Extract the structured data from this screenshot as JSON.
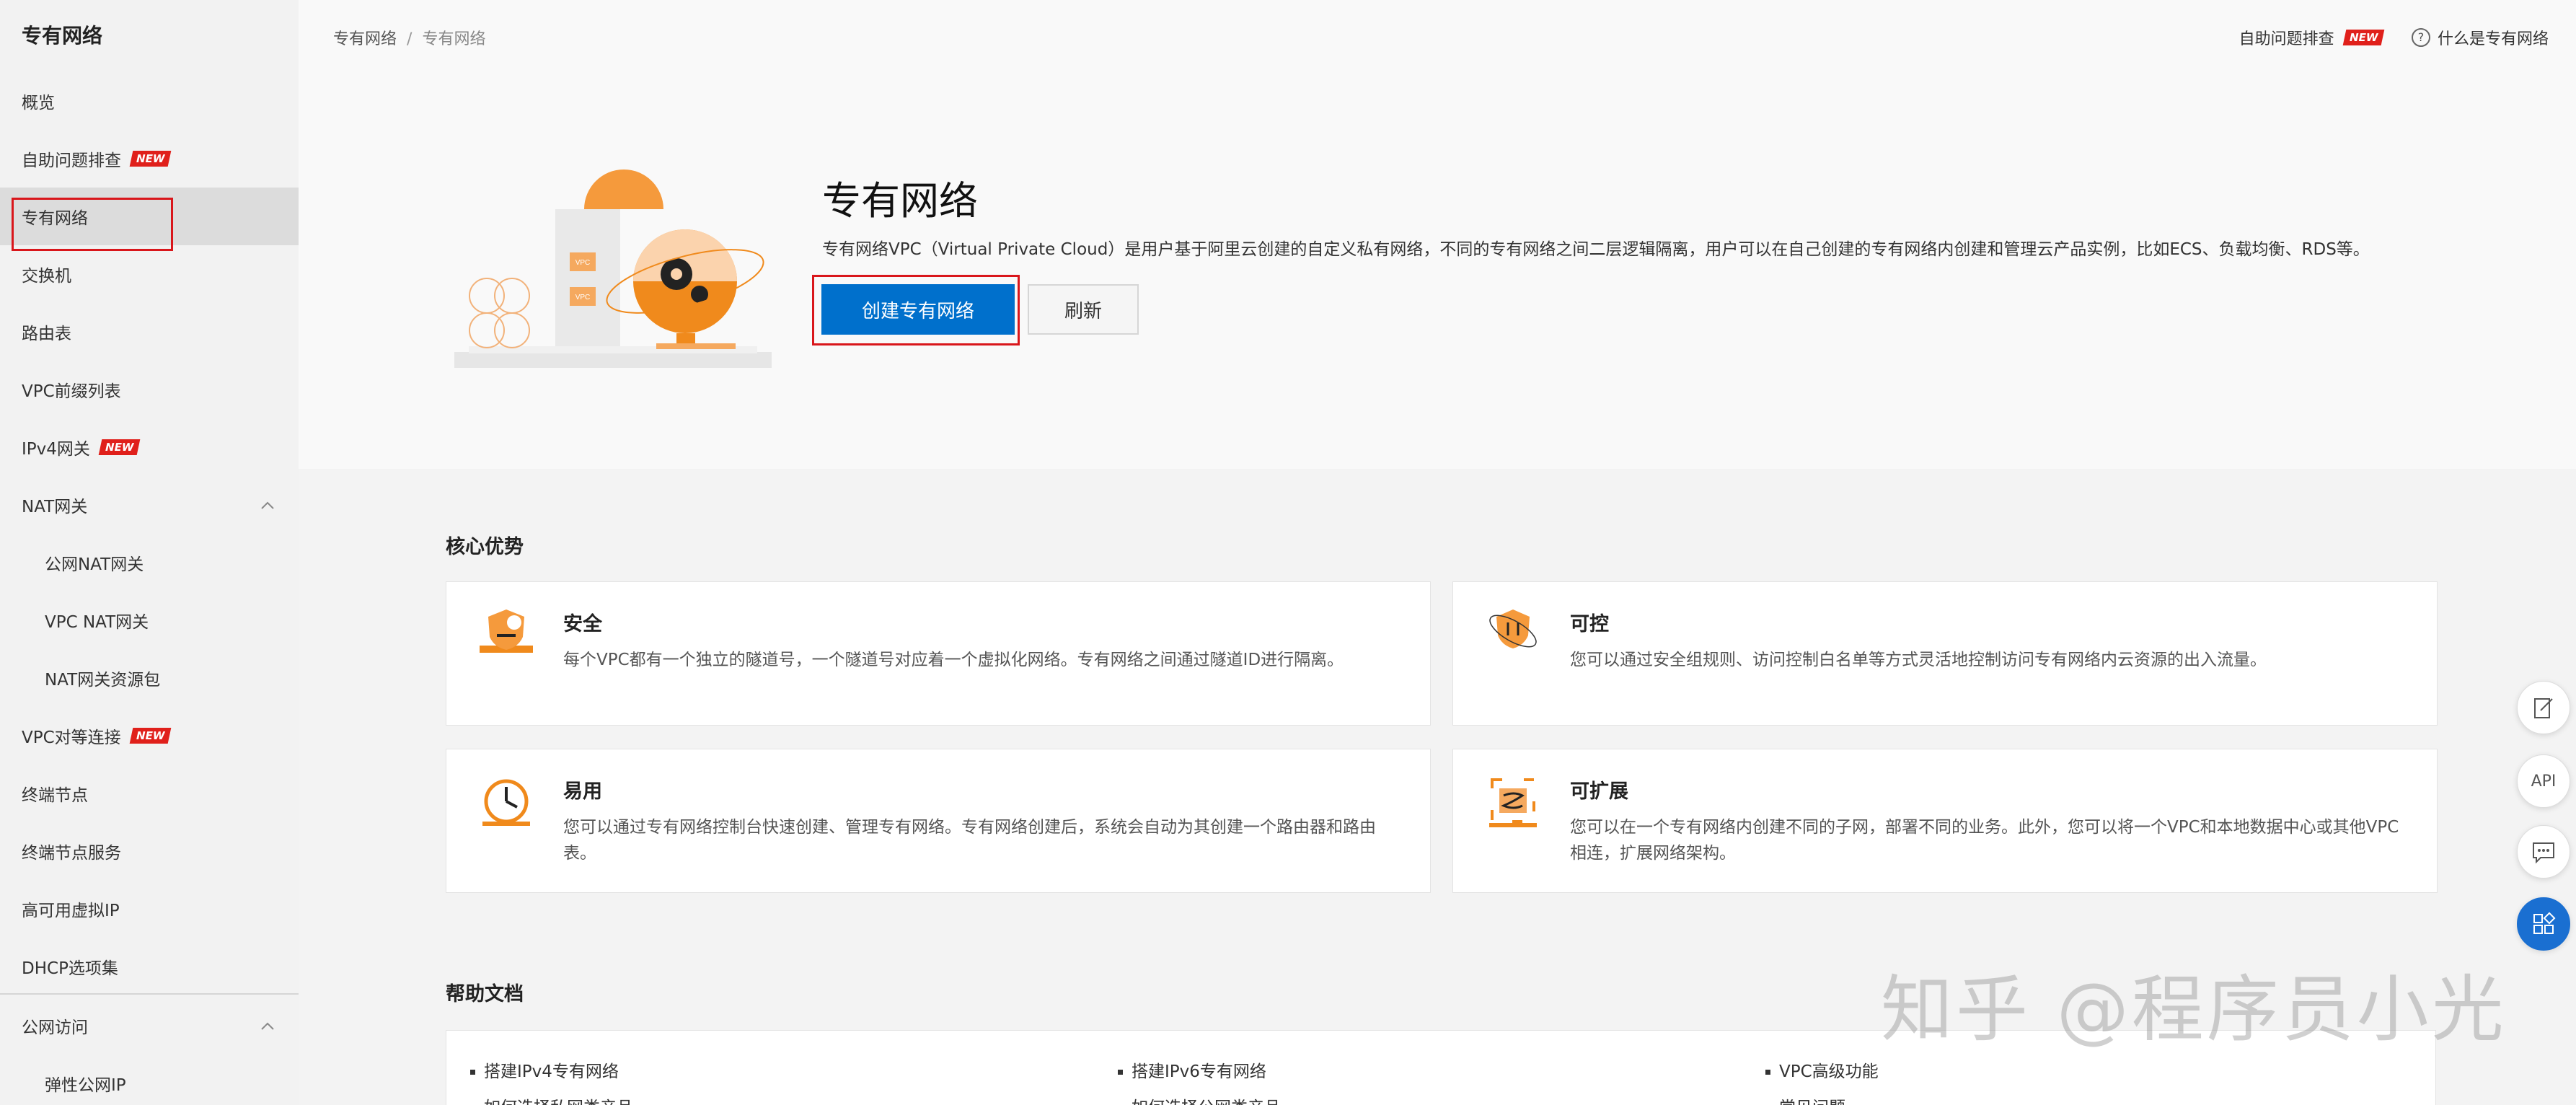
{
  "sidebar": {
    "title": "专有网络",
    "new_badge": "NEW",
    "items": [
      {
        "label": "概览"
      },
      {
        "label": "自助问题排查"
      },
      {
        "label": "专有网络"
      },
      {
        "label": "交换机"
      },
      {
        "label": "路由表"
      },
      {
        "label": "VPC前缀列表"
      },
      {
        "label": "IPv4网关"
      },
      {
        "label": "NAT网关"
      },
      {
        "label": "公网NAT网关"
      },
      {
        "label": "VPC NAT网关"
      },
      {
        "label": "NAT网关资源包"
      },
      {
        "label": "VPC对等连接"
      },
      {
        "label": "终端节点"
      },
      {
        "label": "终端节点服务"
      },
      {
        "label": "高可用虚拟IP"
      },
      {
        "label": "DHCP选项集"
      },
      {
        "label": "公网访问"
      },
      {
        "label": "弹性公网IP"
      }
    ]
  },
  "breadcrumb": {
    "root": "专有网络",
    "sep": "/",
    "current": "专有网络"
  },
  "topright": {
    "troubleshoot": "自助问题排查",
    "new_badge": "NEW",
    "help_q": "?",
    "what_is": "什么是专有网络"
  },
  "hero": {
    "title": "专有网络",
    "description": "专有网络VPC（Virtual Private Cloud）是用户基于阿里云创建的自定义私有网络，不同的专有网络之间二层逻辑隔离，用户可以在自己创建的专有网络内创建和管理云产品实例，比如ECS、负载均衡、RDS等。",
    "create_button": "创建专有网络",
    "refresh_button": "刷新",
    "illus_label_1": "VPC",
    "illus_label_2": "VPC"
  },
  "advantages": {
    "title": "核心优势",
    "cards": [
      {
        "title": "安全",
        "desc": "每个VPC都有一个独立的隧道号，一个隧道号对应着一个虚拟化网络。专有网络之间通过隧道ID进行隔离。"
      },
      {
        "title": "可控",
        "desc": "您可以通过安全组规则、访问控制白名单等方式灵活地控制访问专有网络内云资源的出入流量。"
      },
      {
        "title": "易用",
        "desc": "您可以通过专有网络控制台快速创建、管理专有网络。专有网络创建后，系统会自动为其创建一个路由器和路由表。"
      },
      {
        "title": "可扩展",
        "desc": "您可以在一个专有网络内创建不同的子网，部署不同的业务。此外，您可以将一个VPC和本地数据中心或其他VPC相连，扩展网络架构。"
      }
    ]
  },
  "docs": {
    "title": "帮助文档",
    "links": [
      "搭建IPv4专有网络",
      "搭建IPv6专有网络",
      "VPC高级功能",
      "如何选择私网类产品",
      "如何选择公网类产品",
      "常见问题"
    ]
  },
  "floating": {
    "api_label": "API"
  },
  "watermark": "知乎 @程序员小光",
  "colors": {
    "primary": "#0070cc",
    "badge": "#e0201b",
    "highlight": "#d9161b",
    "accent_orange": "#f08a1c"
  }
}
